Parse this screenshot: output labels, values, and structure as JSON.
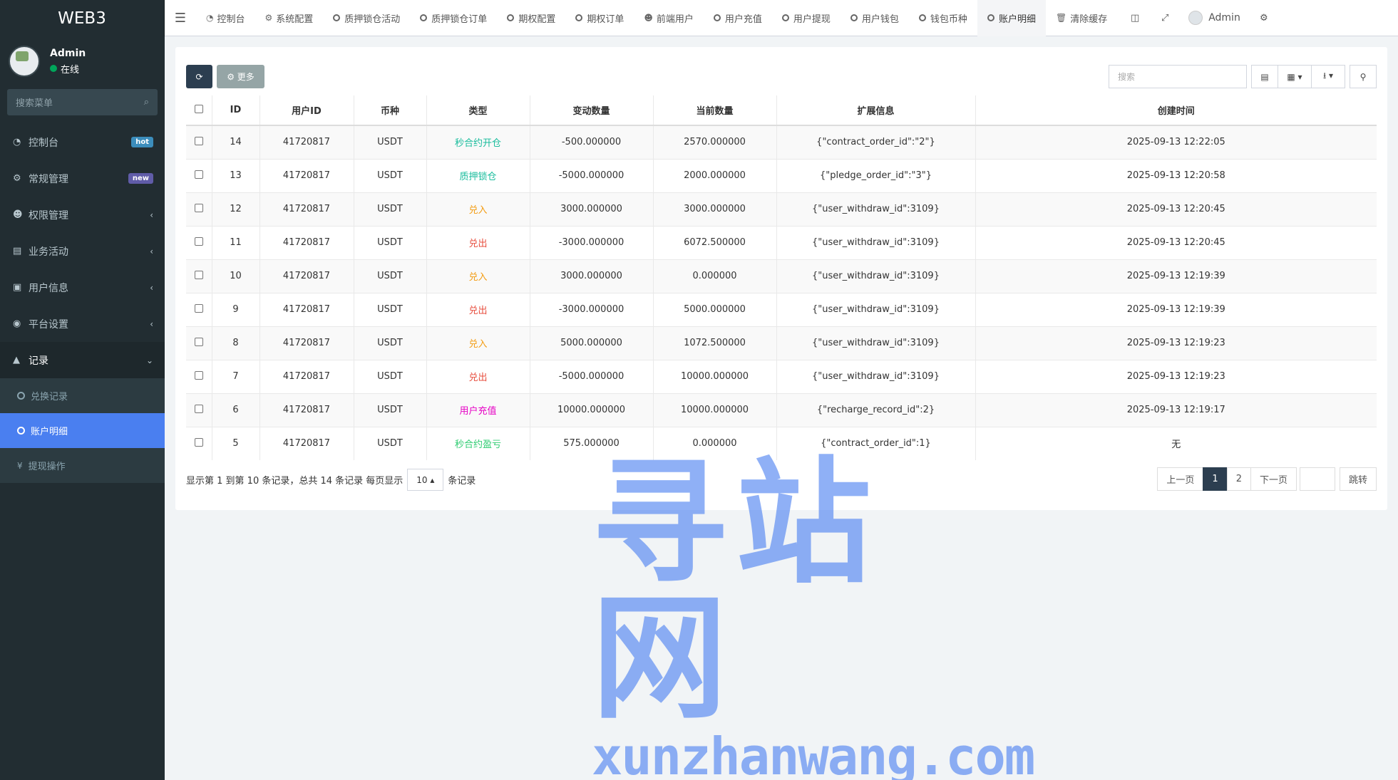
{
  "brand": "WEB3",
  "user": {
    "name": "Admin",
    "status": "在线"
  },
  "sidebar": {
    "search_placeholder": "搜索菜单",
    "items": [
      {
        "label": "控制台",
        "icon": "dashboard-icon",
        "badge": "hot"
      },
      {
        "label": "常规管理",
        "icon": "cogs-icon",
        "badge": "new"
      },
      {
        "label": "权限管理",
        "icon": "group-icon"
      },
      {
        "label": "业务活动",
        "icon": "list-alt-icon"
      },
      {
        "label": "用户信息",
        "icon": "address-book-icon"
      },
      {
        "label": "平台设置",
        "icon": "gear-icon"
      },
      {
        "label": "记录",
        "icon": "area-chart-icon"
      }
    ],
    "sub_items": [
      {
        "label": "兑换记录"
      },
      {
        "label": "账户明细"
      },
      {
        "label": "提现操作"
      }
    ]
  },
  "tabs": [
    {
      "label": "控制台"
    },
    {
      "label": "系统配置"
    },
    {
      "label": "质押锁仓活动"
    },
    {
      "label": "质押锁仓订单"
    },
    {
      "label": "期权配置"
    },
    {
      "label": "期权订单"
    },
    {
      "label": "前端用户"
    },
    {
      "label": "用户充值"
    },
    {
      "label": "用户提现"
    },
    {
      "label": "用户钱包"
    },
    {
      "label": "钱包币种"
    },
    {
      "label": "账户明细"
    },
    {
      "label": "清除缓存"
    }
  ],
  "topbar": {
    "user": "Admin"
  },
  "toolbar": {
    "more": "更多",
    "search_placeholder": "搜索"
  },
  "table": {
    "headers": [
      "ID",
      "用户ID",
      "币种",
      "类型",
      "变动数量",
      "当前数量",
      "扩展信息",
      "创建时间"
    ],
    "rows": [
      {
        "id": "14",
        "uid": "41720817",
        "coin": "USDT",
        "type": "秒合约开仓",
        "type_color": "#18bc9c",
        "change": "-500.000000",
        "current": "2570.000000",
        "ext": "{\"contract_order_id\":\"2\"}",
        "time": "2025-09-13 12:22:05"
      },
      {
        "id": "13",
        "uid": "41720817",
        "coin": "USDT",
        "type": "质押锁仓",
        "type_color": "#18bc9c",
        "change": "-5000.000000",
        "current": "2000.000000",
        "ext": "{\"pledge_order_id\":\"3\"}",
        "time": "2025-09-13 12:20:58"
      },
      {
        "id": "12",
        "uid": "41720817",
        "coin": "USDT",
        "type": "兑入",
        "type_color": "#f39c12",
        "change": "3000.000000",
        "current": "3000.000000",
        "ext": "{\"user_withdraw_id\":3109}",
        "time": "2025-09-13 12:20:45"
      },
      {
        "id": "11",
        "uid": "41720817",
        "coin": "USDT",
        "type": "兑出",
        "type_color": "#e74c3c",
        "change": "-3000.000000",
        "current": "6072.500000",
        "ext": "{\"user_withdraw_id\":3109}",
        "time": "2025-09-13 12:20:45"
      },
      {
        "id": "10",
        "uid": "41720817",
        "coin": "USDT",
        "type": "兑入",
        "type_color": "#f39c12",
        "change": "3000.000000",
        "current": "0.000000",
        "ext": "{\"user_withdraw_id\":3109}",
        "time": "2025-09-13 12:19:39"
      },
      {
        "id": "9",
        "uid": "41720817",
        "coin": "USDT",
        "type": "兑出",
        "type_color": "#e74c3c",
        "change": "-3000.000000",
        "current": "5000.000000",
        "ext": "{\"user_withdraw_id\":3109}",
        "time": "2025-09-13 12:19:39"
      },
      {
        "id": "8",
        "uid": "41720817",
        "coin": "USDT",
        "type": "兑入",
        "type_color": "#f39c12",
        "change": "5000.000000",
        "current": "1072.500000",
        "ext": "{\"user_withdraw_id\":3109}",
        "time": "2025-09-13 12:19:23"
      },
      {
        "id": "7",
        "uid": "41720817",
        "coin": "USDT",
        "type": "兑出",
        "type_color": "#e74c3c",
        "change": "-5000.000000",
        "current": "10000.000000",
        "ext": "{\"user_withdraw_id\":3109}",
        "time": "2025-09-13 12:19:23"
      },
      {
        "id": "6",
        "uid": "41720817",
        "coin": "USDT",
        "type": "用户充值",
        "type_color": "#e600c4",
        "change": "10000.000000",
        "current": "10000.000000",
        "ext": "{\"recharge_record_id\":2}",
        "time": "2025-09-13 12:19:17"
      },
      {
        "id": "5",
        "uid": "41720817",
        "coin": "USDT",
        "type": "秒合约盈亏",
        "type_color": "#2ecc71",
        "change": "575.000000",
        "current": "0.000000",
        "ext": "{\"contract_order_id\":1}",
        "time": "无"
      }
    ]
  },
  "pagination": {
    "summary": "显示第 1 到第 10 条记录，总共 14 条记录 每页显示",
    "page_size": "10",
    "suffix": "条记录",
    "prev": "上一页",
    "pages": [
      "1",
      "2"
    ],
    "next": "下一页",
    "go": "跳转"
  },
  "watermark": {
    "cn": "寻站网",
    "en": "xunzhanwang.com"
  },
  "colors": {
    "sidebar_bg": "#222d32",
    "active_sub": "#4a7ff0",
    "primary_btn": "#2c3e50"
  }
}
